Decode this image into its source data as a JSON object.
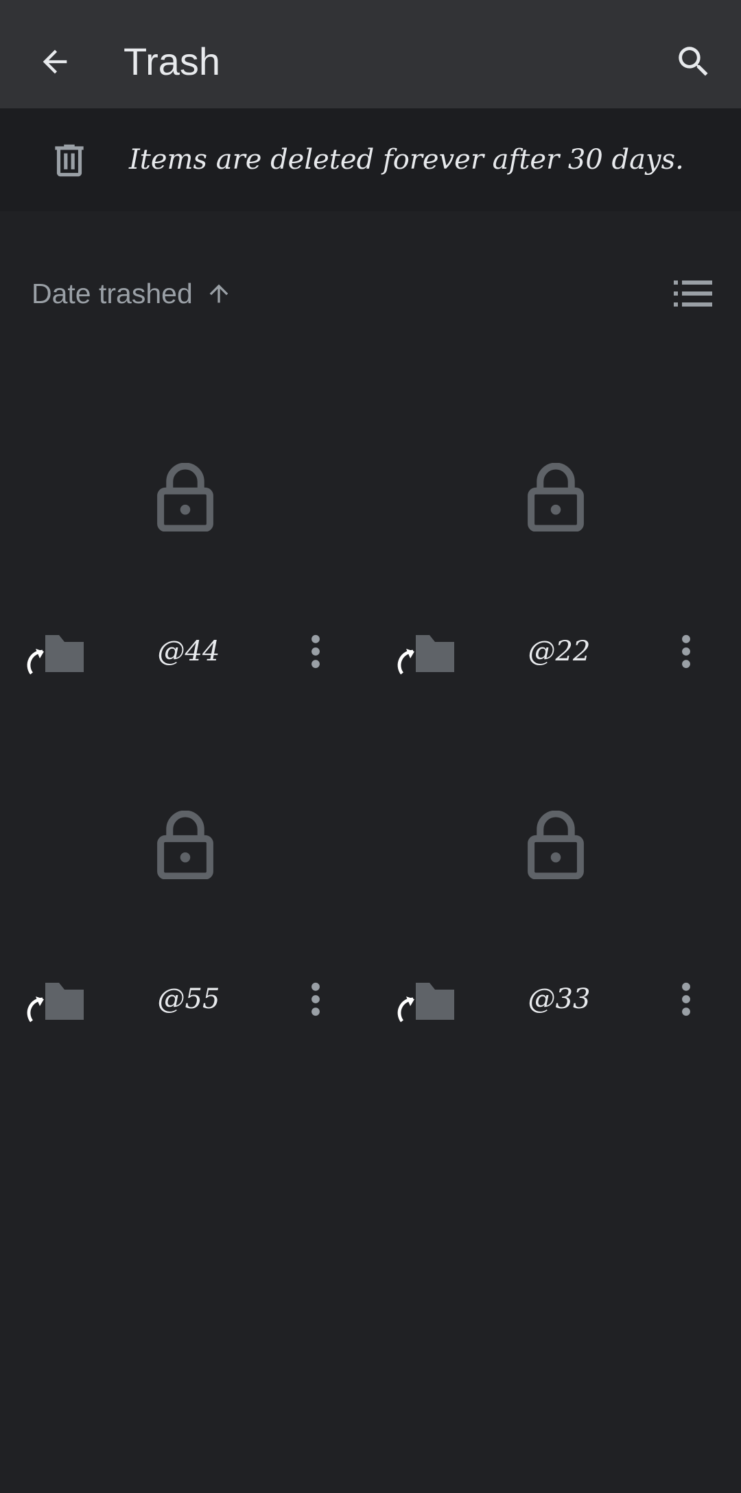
{
  "header": {
    "title": "Trash",
    "back_icon": "arrow-back-icon",
    "search_icon": "search-icon"
  },
  "banner": {
    "icon": "trash-icon",
    "text": "Items are deleted forever after 30 days."
  },
  "sort": {
    "label": "Date trashed",
    "direction_icon": "arrow-up-icon",
    "view_icon": "list-view-icon"
  },
  "items": [
    {
      "name": "@44",
      "thumbnail_icon": "lock-icon",
      "type_icon": "shared-folder-icon",
      "menu_icon": "more-vert-icon"
    },
    {
      "name": "@22",
      "thumbnail_icon": "lock-icon",
      "type_icon": "shared-folder-icon",
      "menu_icon": "more-vert-icon"
    },
    {
      "name": "@55",
      "thumbnail_icon": "lock-icon",
      "type_icon": "shared-folder-icon",
      "menu_icon": "more-vert-icon"
    },
    {
      "name": "@33",
      "thumbnail_icon": "lock-icon",
      "type_icon": "shared-folder-icon",
      "menu_icon": "more-vert-icon"
    }
  ],
  "colors": {
    "background": "#202124",
    "topbar": "#323336",
    "banner": "#1c1d20",
    "text_primary": "#e8eaed",
    "text_secondary": "#9aa0a6",
    "icon_muted": "#5f6368"
  }
}
